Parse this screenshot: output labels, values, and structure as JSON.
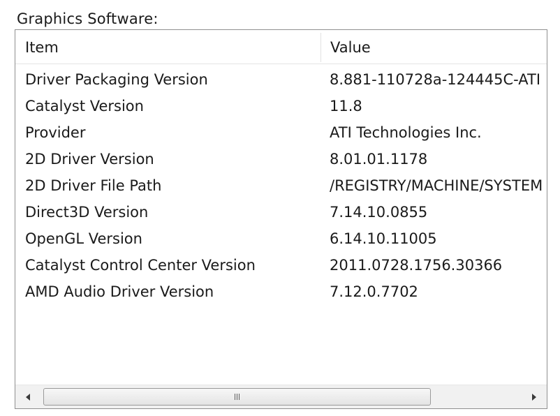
{
  "section": {
    "title": "Graphics Software:"
  },
  "table": {
    "columns": [
      "Item",
      "Value"
    ],
    "rows": [
      {
        "item": "Driver Packaging Version",
        "value": "8.881-110728a-124445C-ATI"
      },
      {
        "item": "Catalyst Version",
        "value": "11.8"
      },
      {
        "item": "Provider",
        "value": "ATI Technologies Inc."
      },
      {
        "item": "2D Driver Version",
        "value": "8.01.01.1178"
      },
      {
        "item": "2D Driver File Path",
        "value": "/REGISTRY/MACHINE/SYSTEM"
      },
      {
        "item": "Direct3D Version",
        "value": "7.14.10.0855"
      },
      {
        "item": "OpenGL Version",
        "value": "6.14.10.11005"
      },
      {
        "item": "Catalyst Control Center Version",
        "value": "2011.0728.1756.30366"
      },
      {
        "item": "AMD Audio Driver Version",
        "value": "7.12.0.7702"
      }
    ]
  },
  "scrollbar": {
    "left_icon": "chevron-left-icon",
    "right_icon": "chevron-right-icon",
    "grip_icon": "grip-icon"
  }
}
